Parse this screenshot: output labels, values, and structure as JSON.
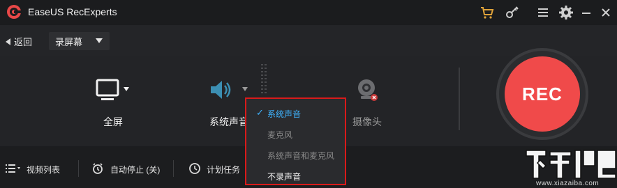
{
  "app": {
    "title": "EaseUS RecExperts"
  },
  "titlebar": {
    "icons": [
      "cart-icon",
      "key-icon",
      "menu-icon",
      "gear-icon",
      "minimize-icon",
      "close-icon"
    ]
  },
  "subbar": {
    "back_label": "返回",
    "mode_value": "录屏幕"
  },
  "options": {
    "screen_label": "全屏",
    "audio_label": "系统声音",
    "webcam_label": "摄像头"
  },
  "rec": {
    "label": "REC"
  },
  "bottom": {
    "video_list": "视频列表",
    "auto_stop": "自动停止 (关)",
    "schedule": "计划任务"
  },
  "audio_dropdown": {
    "items": [
      "系统声音",
      "麦克风",
      "系统声音和麦克风",
      "不录声音"
    ],
    "selected": "系统声音"
  },
  "watermark": {
    "site": "www.xiazaiba.com"
  },
  "colors": {
    "rec": "#f04a4a",
    "accent": "#3fb4ff",
    "highlight_border": "#d91a1a"
  }
}
